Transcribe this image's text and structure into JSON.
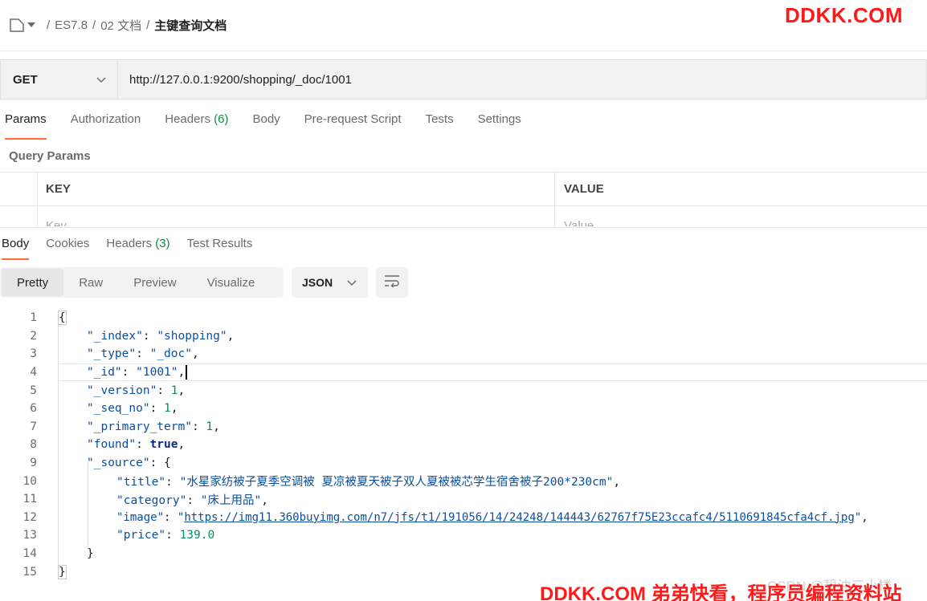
{
  "breadcrumb": {
    "items": [
      "ES7.8",
      "02 文档"
    ],
    "current": "主键查询文档",
    "separator": "/"
  },
  "watermarks": {
    "top": "DDKK.COM",
    "bottom": "DDKK.COM 弟弟快看，程序员编程资料站",
    "faint": "CSDN @碧油三小楼"
  },
  "request": {
    "method": "GET",
    "url": "http://127.0.0.1:9200/shopping/_doc/1001"
  },
  "request_tabs": [
    {
      "label": "Params",
      "count": ""
    },
    {
      "label": "Authorization",
      "count": ""
    },
    {
      "label": "Headers",
      "count": "(6)"
    },
    {
      "label": "Body",
      "count": ""
    },
    {
      "label": "Pre-request Script",
      "count": ""
    },
    {
      "label": "Tests",
      "count": ""
    },
    {
      "label": "Settings",
      "count": ""
    }
  ],
  "query_params": {
    "title": "Query Params",
    "key_header": "KEY",
    "value_header": "VALUE",
    "key_placeholder": "Key",
    "value_placeholder": "Value"
  },
  "response_tabs": [
    {
      "label": "Body",
      "count": ""
    },
    {
      "label": "Cookies",
      "count": ""
    },
    {
      "label": "Headers",
      "count": "(3)"
    },
    {
      "label": "Test Results",
      "count": ""
    }
  ],
  "view_modes": [
    "Pretty",
    "Raw",
    "Preview",
    "Visualize"
  ],
  "format": "JSON",
  "response_body": {
    "line_numbers": [
      "1",
      "2",
      "3",
      "4",
      "5",
      "6",
      "7",
      "8",
      "9",
      "10",
      "11",
      "12",
      "13",
      "14",
      "15"
    ],
    "_index": "shopping",
    "_type": "_doc",
    "_id": "1001",
    "_version": "1",
    "_seq_no": "1",
    "_primary_term": "1",
    "found": "true",
    "title": "水星家纺被子夏季空调被 夏凉被夏天被子双人夏被被芯学生宿舍被子200*230cm",
    "category": "床上用品",
    "image": "https://img11.360buyimg.com/n7/jfs/t1/191056/14/24248/144443/62767f75E23ccafc4/5110691845cfa4cf.jpg",
    "price": "139.0"
  },
  "colors": {
    "accent": "#ff6c37",
    "count_green": "#0a8f3d",
    "json_key": "#0a4f9e",
    "json_number": "#0a8f5c",
    "watermark": "#ff1a1a"
  }
}
